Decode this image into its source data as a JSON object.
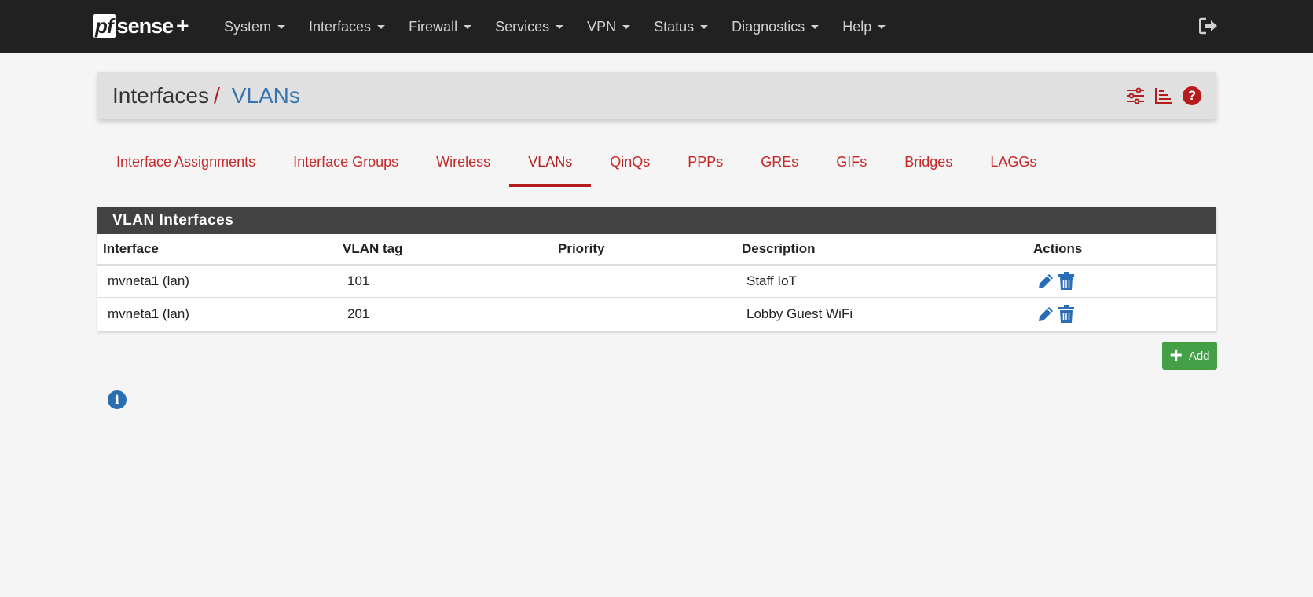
{
  "brand": {
    "pf": "pf",
    "name": "sense",
    "plus": "+"
  },
  "nav": [
    {
      "label": "System",
      "id": "system"
    },
    {
      "label": "Interfaces",
      "id": "interfaces"
    },
    {
      "label": "Firewall",
      "id": "firewall"
    },
    {
      "label": "Services",
      "id": "services"
    },
    {
      "label": "VPN",
      "id": "vpn"
    },
    {
      "label": "Status",
      "id": "status"
    },
    {
      "label": "Diagnostics",
      "id": "diagnostics"
    },
    {
      "label": "Help",
      "id": "help"
    }
  ],
  "breadcrumb": {
    "parent": "Interfaces",
    "separator": "/",
    "current": "VLANs"
  },
  "tabs": [
    {
      "label": "Interface Assignments",
      "active": false
    },
    {
      "label": "Interface Groups",
      "active": false
    },
    {
      "label": "Wireless",
      "active": false
    },
    {
      "label": "VLANs",
      "active": true
    },
    {
      "label": "QinQs",
      "active": false
    },
    {
      "label": "PPPs",
      "active": false
    },
    {
      "label": "GREs",
      "active": false
    },
    {
      "label": "GIFs",
      "active": false
    },
    {
      "label": "Bridges",
      "active": false
    },
    {
      "label": "LAGGs",
      "active": false
    }
  ],
  "panel": {
    "title": "VLAN Interfaces",
    "columns": [
      "Interface",
      "VLAN tag",
      "Priority",
      "Description",
      "Actions"
    ],
    "rows": [
      {
        "interface": "mvneta1 (lan)",
        "vlan_tag": "101",
        "priority": "",
        "description": "Staff IoT"
      },
      {
        "interface": "mvneta1 (lan)",
        "vlan_tag": "201",
        "priority": "",
        "description": "Lobby Guest WiFi"
      }
    ]
  },
  "add_button": {
    "label": "Add"
  },
  "info_icon": {
    "glyph": "i"
  },
  "help_icon": {
    "glyph": "?"
  },
  "colors": {
    "navbar": "#212121",
    "accent_red": "#b71c1c",
    "link_blue": "#3574b0",
    "panel_heading": "#424242",
    "add_green": "#43a047"
  },
  "icons": {
    "logout": "sign-out-icon",
    "settings": "sliders-icon",
    "chart": "bar-chart-icon",
    "help": "question-circle-icon",
    "edit": "pencil-icon",
    "delete": "trash-icon",
    "info": "info-circle-icon"
  }
}
